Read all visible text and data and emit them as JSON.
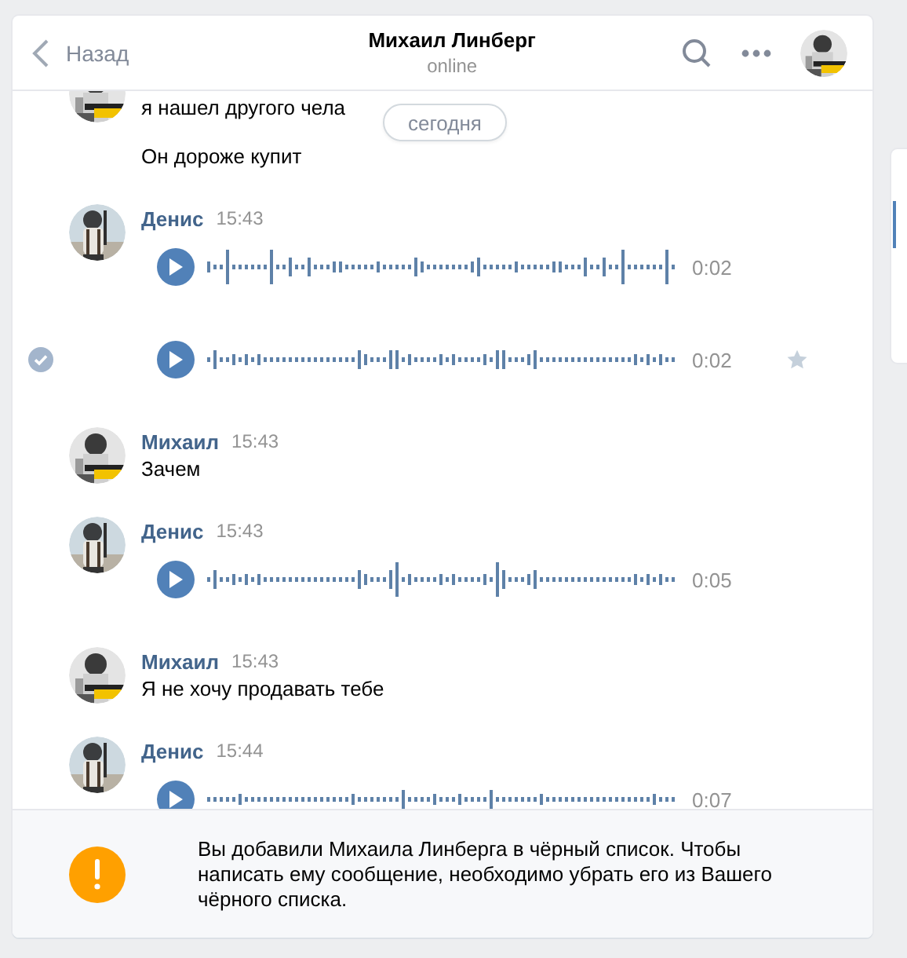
{
  "header": {
    "back": "Назад",
    "title": "Михаил Линберг",
    "status": "online"
  },
  "date_pill": "сегодня",
  "groups": [
    {
      "items": [
        {
          "kind": "text",
          "text": "я нашел другого чела"
        },
        {
          "kind": "text",
          "text": "Он дороже купит"
        }
      ]
    },
    {
      "author": "Денис",
      "time": "15:43",
      "items": [
        {
          "kind": "voice",
          "duration": "0:02",
          "hover": false
        },
        {
          "kind": "voice",
          "duration": "0:02",
          "hover": true
        }
      ]
    },
    {
      "author": "Михаил",
      "time": "15:43",
      "items": [
        {
          "kind": "text",
          "text": "Зачем"
        }
      ]
    },
    {
      "author": "Денис",
      "time": "15:43",
      "items": [
        {
          "kind": "voice",
          "duration": "0:05",
          "hover": false
        }
      ]
    },
    {
      "author": "Михаил",
      "time": "15:43",
      "items": [
        {
          "kind": "text",
          "text": "Я не хочу продавать тебе"
        }
      ]
    },
    {
      "author": "Денис",
      "time": "15:44",
      "items": [
        {
          "kind": "voice",
          "duration": "0:07",
          "hover": false
        }
      ]
    }
  ],
  "notice": "Вы добавили Михаила Линберга в чёрный список. Чтобы написать ему сообщение, необходимо убрать его из Вашего чёрного списка."
}
